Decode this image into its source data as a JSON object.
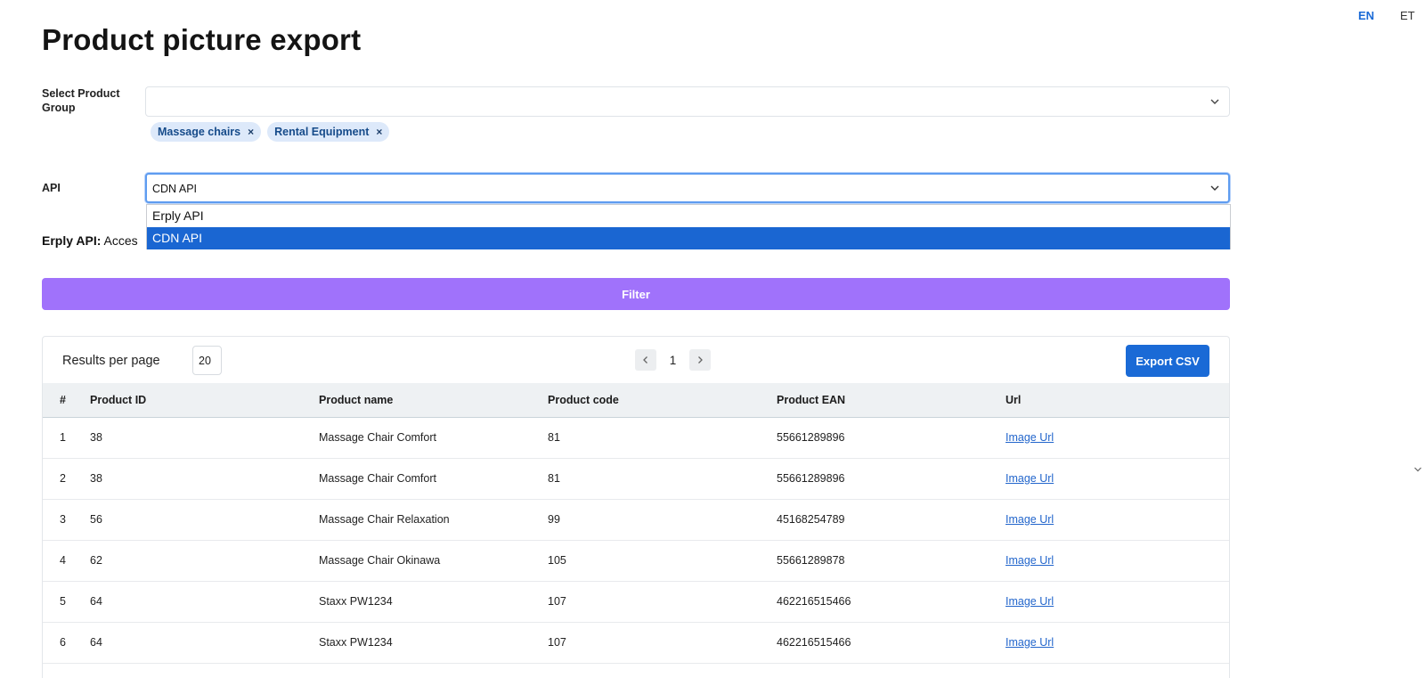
{
  "languages": [
    "EN",
    "ET"
  ],
  "page": {
    "title": "Product picture export"
  },
  "form": {
    "group_label": "Select Product Group",
    "chips": [
      "Massage chairs",
      "Rental Equipment"
    ],
    "chip_remove_glyph": "×",
    "api_label": "API",
    "api_value": "CDN API",
    "api_options": [
      "Erply API",
      "CDN API"
    ],
    "info_bold": "Erply API:",
    "info_text": "Acces",
    "filter_label": "Filter"
  },
  "results": {
    "per_page_label": "Results per page",
    "per_page_value": "20",
    "page_number": "1",
    "export_label": "Export CSV",
    "columns": [
      "#",
      "Product ID",
      "Product name",
      "Product code",
      "Product EAN",
      "Url"
    ],
    "rows": [
      [
        "1",
        "38",
        "Massage Chair Comfort",
        "81",
        "55661289896",
        "Image Url"
      ],
      [
        "2",
        "38",
        "Massage Chair Comfort",
        "81",
        "55661289896",
        "Image Url"
      ],
      [
        "3",
        "56",
        "Massage Chair Relaxation",
        "99",
        "45168254789",
        "Image Url"
      ],
      [
        "4",
        "62",
        "Massage Chair Okinawa",
        "105",
        "55661289878",
        "Image Url"
      ],
      [
        "5",
        "64",
        "Staxx PW1234",
        "107",
        "462216515466",
        "Image Url"
      ],
      [
        "6",
        "64",
        "Staxx PW1234",
        "107",
        "462216515466",
        "Image Url"
      ]
    ]
  },
  "colors": {
    "accent_blue": "#1a6ad6",
    "filter_purple": "#a072fb",
    "chip_bg": "#dde9fa",
    "selected_option": "#1a66d2"
  },
  "icons": [
    "chevron-down-icon",
    "chevron-left-icon",
    "chevron-right-icon",
    "close-icon"
  ]
}
